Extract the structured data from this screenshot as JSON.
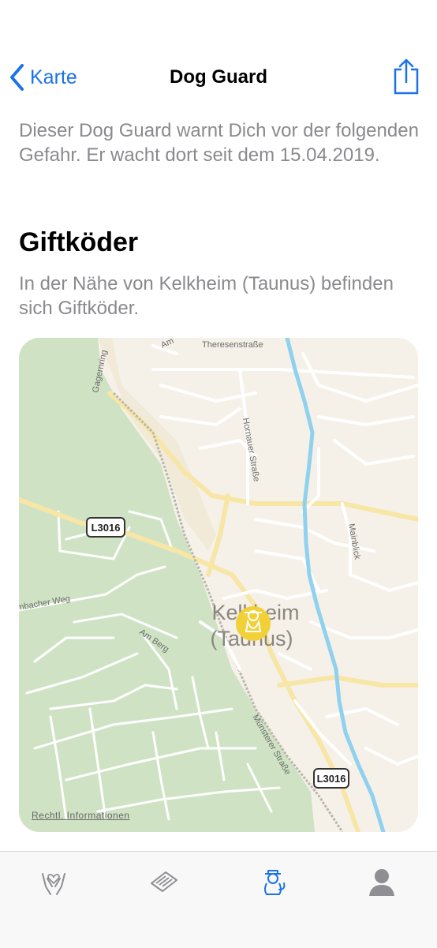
{
  "nav": {
    "back_label": "Karte",
    "title": "Dog Guard"
  },
  "intro": {
    "text": "Dieser Dog Guard warnt Dich vor der folgenden Gefahr. Er wacht dort seit dem 15.04.2019."
  },
  "hazard": {
    "title": "Giftköder",
    "description": "In der Nähe von Kelkheim (Taunus) befinden sich Giftköder."
  },
  "map": {
    "city_label_line1": "Kelkheim",
    "city_label_line2": "(Taunus)",
    "road_shield_1": "L3016",
    "road_shield_2": "L3016",
    "street_labels": {
      "theresenstrasse": "Theresenstraße",
      "gagernring": "Gagernring",
      "hornauer": "Hornauer Straße",
      "mainblick": "Mainblick",
      "bacher_weg": "mbacher Weg",
      "am_berg": "Am Berg",
      "muensterer": "Münsterer Straße",
      "am_top": "Am"
    },
    "legal_link": "Rechtl. Informationen",
    "marker_icon": "dog-guard-marker-icon",
    "colors": {
      "forest": "#cfe3c4",
      "land": "#f5f1e8",
      "river": "#8fd1ee",
      "main_road": "#f7e6a6",
      "marker": "#f2d038"
    }
  },
  "tabbar": {
    "items": [
      "hands-heart-icon",
      "newspaper-icon",
      "dog-guard-icon",
      "profile-icon"
    ],
    "active": "dog-guard-icon",
    "active_color": "#1a73e8",
    "inactive_color": "#8e8e93"
  }
}
